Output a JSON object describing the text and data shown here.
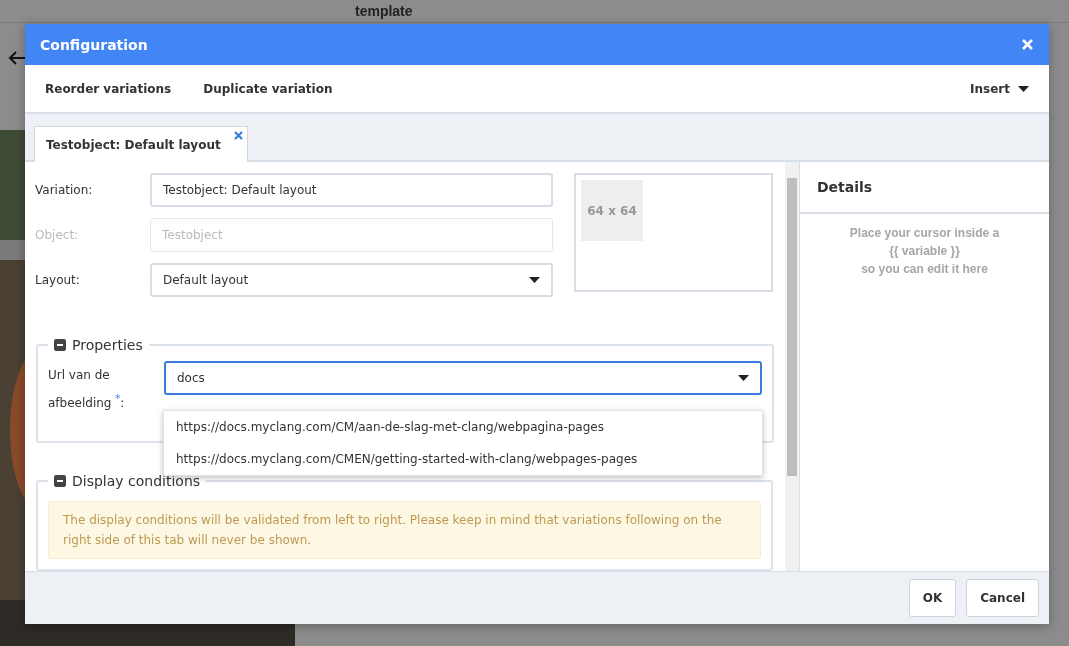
{
  "backdrop": {
    "toolbar_text": "template"
  },
  "dialog": {
    "title": "Configuration",
    "toolbar": {
      "actions": [
        "Reorder variations",
        "Duplicate variation"
      ],
      "insert": "Insert"
    },
    "tabs": [
      {
        "label": "Testobject: Default layout",
        "selected": true
      }
    ],
    "form": {
      "fields": [
        {
          "kind": "text",
          "label": "Variation:",
          "value": "Testobject: Default layout",
          "disabled": false
        },
        {
          "kind": "text",
          "label": "Object:",
          "value": "Testobject",
          "disabled": true
        },
        {
          "kind": "select",
          "label": "Layout:",
          "value": "Default layout",
          "disabled": false
        }
      ],
      "image_placeholder": "64 x 64"
    },
    "properties": {
      "legend": "Properties",
      "expanded": true,
      "field": {
        "label": "Url van de afbeelding",
        "required_mark": "*",
        "label_suffix": ":",
        "value": "docs",
        "focused": true
      },
      "suggestions": [
        "https://docs.myclang.com/CM/aan-de-slag-met-clang/webpagina-pages",
        "https://docs.myclang.com/CMEN/getting-started-with-clang/webpages-pages"
      ]
    },
    "display_conditions": {
      "legend": "Display conditions",
      "expanded": true,
      "notice": "The display conditions will be validated from left to right. Please keep in mind that variations following on the right side of this tab will never be shown."
    },
    "details": {
      "title": "Details",
      "hint_lines": [
        "Place your cursor inside a",
        "{{ variable }}",
        "so you can edit it here"
      ]
    },
    "buttons": [
      "OK",
      "Cancel"
    ]
  }
}
